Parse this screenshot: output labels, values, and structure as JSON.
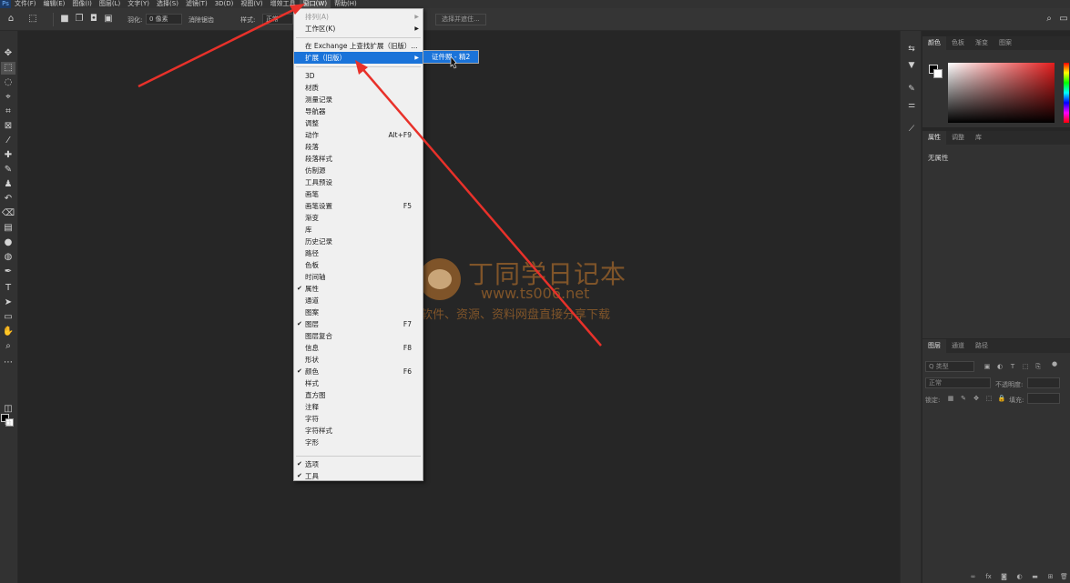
{
  "menubar": {
    "items": [
      "文件(F)",
      "编辑(E)",
      "图像(I)",
      "图层(L)",
      "文字(Y)",
      "选择(S)",
      "滤镜(T)",
      "3D(D)",
      "视图(V)",
      "增效工具",
      "窗口(W)",
      "帮助(H)"
    ],
    "active_index": 10
  },
  "options": {
    "feather_label": "羽化:",
    "feather_value": "0 像素",
    "antialias_label": "消除锯齿",
    "style_label": "样式:",
    "style_value": "正常",
    "select_subject": "选择并遮住..."
  },
  "window_menu": {
    "arrange": "排列(A)",
    "workspace": "工作区(K)",
    "find_ext": "在 Exchange 上查找扩展（旧版）...",
    "extensions": "扩展（旧版）",
    "items": [
      {
        "label": "3D",
        "shortcut": "",
        "checked": false
      },
      {
        "label": "材质",
        "shortcut": "",
        "checked": false
      },
      {
        "label": "测量记录",
        "shortcut": "",
        "checked": false
      },
      {
        "label": "导航器",
        "shortcut": "",
        "checked": false
      },
      {
        "label": "调整",
        "shortcut": "",
        "checked": false
      },
      {
        "label": "动作",
        "shortcut": "Alt+F9",
        "checked": false
      },
      {
        "label": "段落",
        "shortcut": "",
        "checked": false
      },
      {
        "label": "段落样式",
        "shortcut": "",
        "checked": false
      },
      {
        "label": "仿制源",
        "shortcut": "",
        "checked": false
      },
      {
        "label": "工具预设",
        "shortcut": "",
        "checked": false
      },
      {
        "label": "画笔",
        "shortcut": "",
        "checked": false
      },
      {
        "label": "画笔设置",
        "shortcut": "F5",
        "checked": false
      },
      {
        "label": "渐变",
        "shortcut": "",
        "checked": false
      },
      {
        "label": "库",
        "shortcut": "",
        "checked": false
      },
      {
        "label": "历史记录",
        "shortcut": "",
        "checked": false
      },
      {
        "label": "路径",
        "shortcut": "",
        "checked": false
      },
      {
        "label": "色板",
        "shortcut": "",
        "checked": false
      },
      {
        "label": "时间轴",
        "shortcut": "",
        "checked": false
      },
      {
        "label": "属性",
        "shortcut": "",
        "checked": true
      },
      {
        "label": "通道",
        "shortcut": "",
        "checked": false
      },
      {
        "label": "图案",
        "shortcut": "",
        "checked": false
      },
      {
        "label": "图层",
        "shortcut": "F7",
        "checked": true
      },
      {
        "label": "图层复合",
        "shortcut": "",
        "checked": false
      },
      {
        "label": "信息",
        "shortcut": "F8",
        "checked": false
      },
      {
        "label": "形状",
        "shortcut": "",
        "checked": false
      },
      {
        "label": "颜色",
        "shortcut": "F6",
        "checked": true
      },
      {
        "label": "样式",
        "shortcut": "",
        "checked": false
      },
      {
        "label": "直方图",
        "shortcut": "",
        "checked": false
      },
      {
        "label": "注释",
        "shortcut": "",
        "checked": false
      },
      {
        "label": "字符",
        "shortcut": "",
        "checked": false
      },
      {
        "label": "字符样式",
        "shortcut": "",
        "checked": false
      },
      {
        "label": "字形",
        "shortcut": "",
        "checked": false
      }
    ],
    "options_item": "选项",
    "tools_item": "工具"
  },
  "submenu": {
    "item": "证件照 - 精2"
  },
  "color_panel": {
    "tabs": [
      "颜色",
      "色板",
      "渐变",
      "图案"
    ],
    "hue_color": "#e31d1d"
  },
  "props_panel": {
    "tabs": [
      "属性",
      "调整",
      "库"
    ],
    "empty_text": "无属性"
  },
  "layers_panel": {
    "tabs": [
      "图层",
      "通道",
      "路径"
    ],
    "kind_placeholder": "Q 类型",
    "blend_mode": "正常",
    "opacity_label": "不透明度:",
    "lock_label": "锁定:",
    "fill_label": "填充:"
  },
  "watermark": {
    "title": "丁同学日记本",
    "url": "www.ts006.net",
    "slogan": "软件、资源、资料网盘直接分享下载"
  }
}
